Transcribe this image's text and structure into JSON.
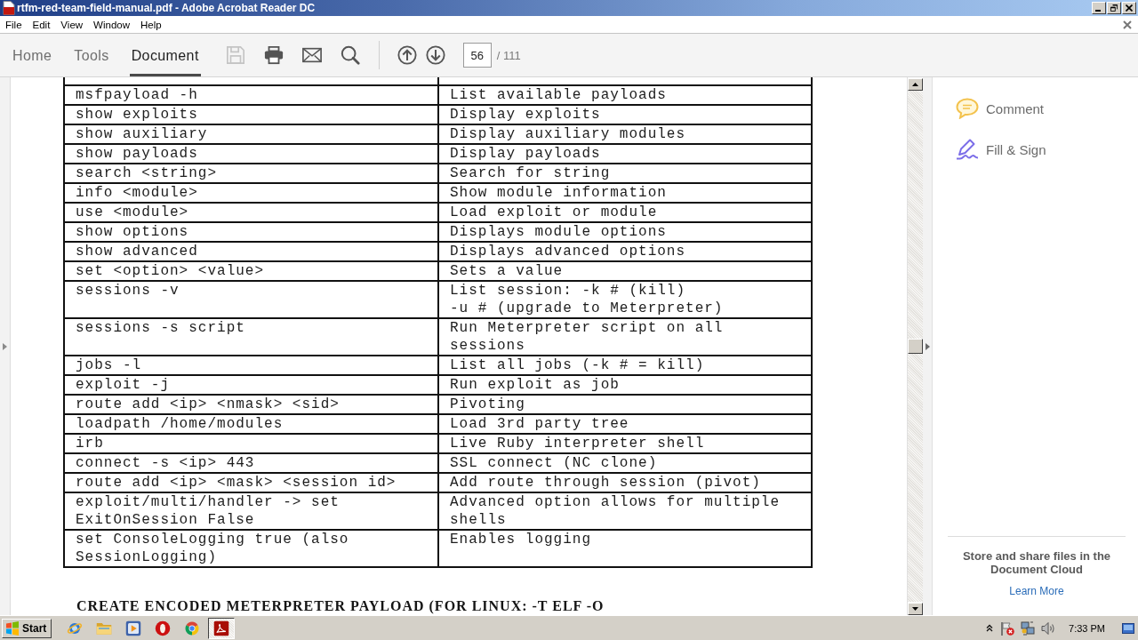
{
  "window": {
    "title": "rtfm-red-team-field-manual.pdf - Adobe Acrobat Reader DC"
  },
  "menu": [
    "File",
    "Edit",
    "View",
    "Window",
    "Help"
  ],
  "tabs": [
    {
      "label": "Home",
      "selected": false
    },
    {
      "label": "Tools",
      "selected": false
    },
    {
      "label": "Document",
      "selected": true
    }
  ],
  "toolbar_buttons": [
    {
      "kind": "save",
      "disabled": true
    },
    {
      "kind": "print",
      "disabled": false
    },
    {
      "kind": "mail",
      "disabled": false
    },
    {
      "kind": "search",
      "disabled": false
    }
  ],
  "page_buttons": [
    {
      "kind": "previous",
      "disabled": false
    },
    {
      "kind": "next",
      "disabled": false
    }
  ],
  "page_number": {
    "value": "56",
    "total": "/ 111"
  },
  "document": {
    "table": {
      "rows": [
        {
          "command": "msfpayload -h",
          "description": "List available payloads"
        },
        {
          "command": "show exploits",
          "description": "Display exploits"
        },
        {
          "command": "show auxiliary",
          "description": "Display auxiliary modules"
        },
        {
          "command": "show payloads",
          "description": "Display payloads"
        },
        {
          "command": "search <string>",
          "description": "Search for string"
        },
        {
          "command": "info <module>",
          "description": "Show module information"
        },
        {
          "command": "use <module>",
          "description": "Load exploit or module"
        },
        {
          "command": "show options",
          "description": "Displays module options"
        },
        {
          "command": "show advanced",
          "description": "Displays advanced options"
        },
        {
          "command": "set <option> <value>",
          "description": "Sets a value"
        },
        {
          "command": "sessions -v",
          "description": "List session: -k # (kill)\n-u # (upgrade to Meterpreter)"
        },
        {
          "command": "sessions -s script",
          "description": "Run Meterpreter script on all sessions"
        },
        {
          "command": "jobs -l",
          "description": "List all jobs (-k # = kill)"
        },
        {
          "command": "exploit -j",
          "description": "Run exploit as job"
        },
        {
          "command": "route add <ip> <nmask> <sid>",
          "description": "Pivoting"
        },
        {
          "command": "loadpath /home/modules",
          "description": "Load 3rd party tree"
        },
        {
          "command": "irb",
          "description": "Live Ruby interpreter shell"
        },
        {
          "command": "connect -s <ip> 443",
          "description": "SSL connect (NC clone)"
        },
        {
          "command": "route add <ip> <mask> <session id>",
          "description": "Add route through session (pivot)"
        },
        {
          "command": "exploit/multi/handler -> set ExitOnSession False",
          "description": "Advanced option allows for multiple shells"
        },
        {
          "command": "set ConsoleLogging true (also SessionLogging)",
          "description": "Enables logging"
        }
      ]
    },
    "heading": "CREATE ENCODED METERPRETER PAYLOAD (FOR LINUX: -T ELF -O"
  },
  "right_panel": {
    "tools": [
      {
        "kind": "comment",
        "label": "Comment"
      },
      {
        "kind": "fill_sign",
        "label": "Fill & Sign"
      }
    ],
    "promo": {
      "text": "Store and share files in the Document Cloud",
      "link": "Learn More"
    }
  },
  "taskbar": {
    "start": "Start",
    "apps": [
      {
        "kind": "globe",
        "active": false
      },
      {
        "kind": "folder",
        "active": false
      },
      {
        "kind": "media",
        "active": false
      },
      {
        "kind": "ring",
        "active": false
      },
      {
        "kind": "segmented_circle",
        "active": false
      },
      {
        "kind": "pdf",
        "active": true
      }
    ],
    "clock": "7:33 PM"
  }
}
